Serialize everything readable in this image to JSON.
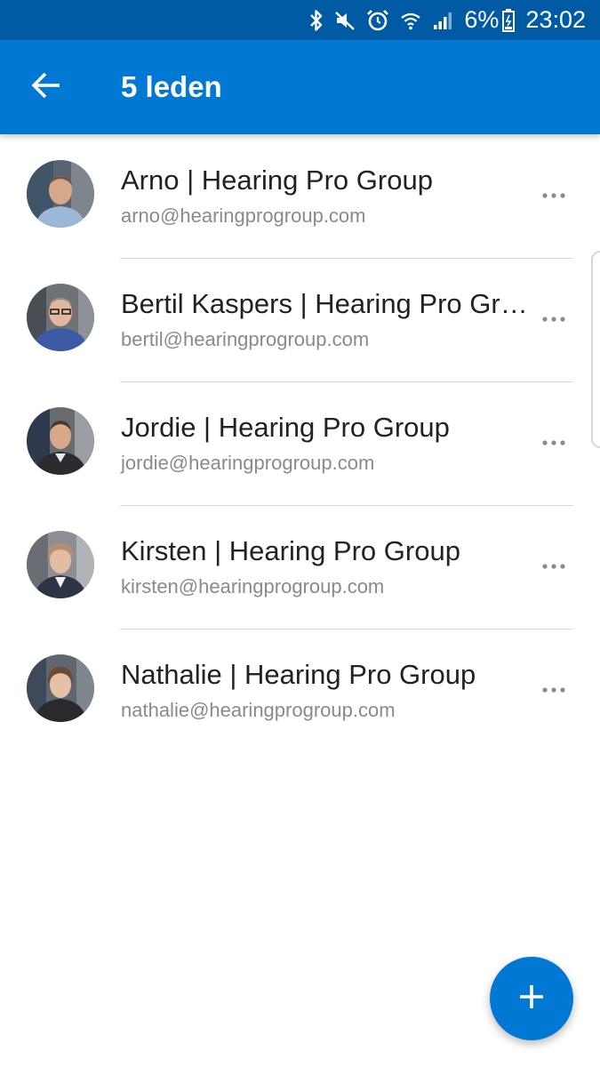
{
  "status_bar": {
    "battery_percent": "6%",
    "time": "23:02",
    "icons": [
      "bluetooth-icon",
      "mute-icon",
      "alarm-icon",
      "wifi-icon",
      "signal-icon",
      "battery-icon"
    ]
  },
  "app_bar": {
    "title": "5 leden",
    "back_icon": "arrow-left-icon"
  },
  "members": [
    {
      "name": "Arno | Hearing Pro Group",
      "email": "arno@hearingprogroup.com"
    },
    {
      "name": "Bertil Kaspers | Hearing Pro Group",
      "email": "bertil@hearingprogroup.com"
    },
    {
      "name": "Jordie | Hearing Pro Group",
      "email": "jordie@hearingprogroup.com"
    },
    {
      "name": "Kirsten | Hearing Pro Group",
      "email": "kirsten@hearingprogroup.com"
    },
    {
      "name": "Nathalie | Hearing Pro Group",
      "email": "nathalie@hearingprogroup.com"
    }
  ],
  "fab": {
    "icon": "plus-icon"
  },
  "colors": {
    "status_bar": "#005ba4",
    "app_bar": "#0078d4",
    "accent": "#0078d4"
  }
}
